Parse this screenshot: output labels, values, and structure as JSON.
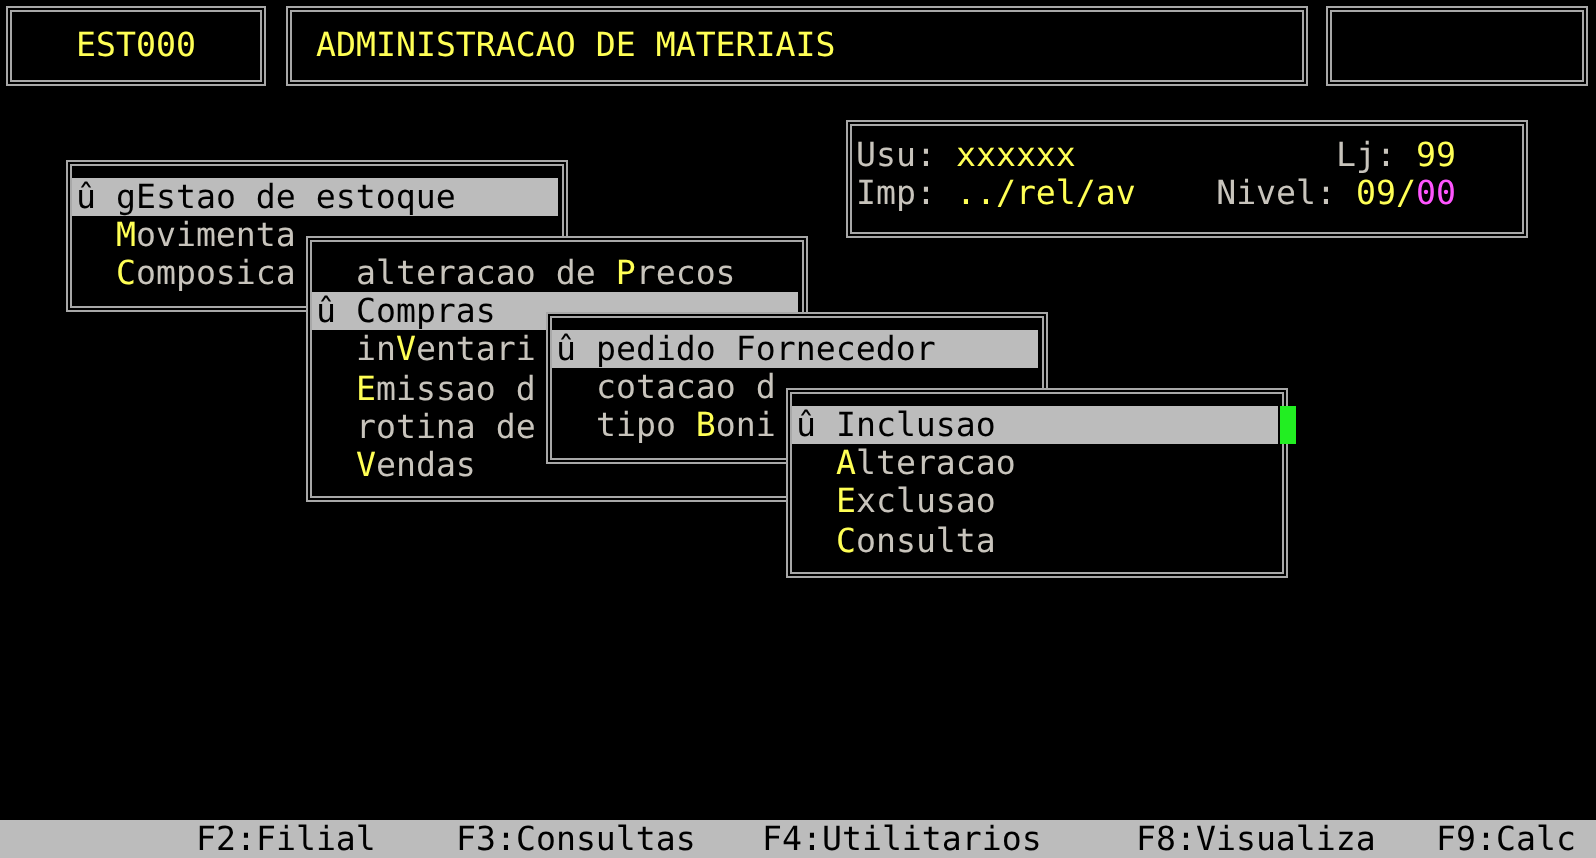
{
  "header": {
    "program_code": "EST000",
    "title": "ADMINISTRACAO DE MATERIAIS"
  },
  "session": {
    "user_label": "Usu:",
    "user": "xxxxxx",
    "store_label": "Lj:",
    "store": "99",
    "printer_label": "Imp:",
    "printer": "../rel/av",
    "level_label": "Nivel:",
    "level_main": "09/",
    "level_sub": "00"
  },
  "menus": [
    {
      "items": [
        {
          "marker": "û",
          "pre": "g",
          "key": "E",
          "post": "stao de estoque",
          "selected": true
        },
        {
          "key": "M",
          "post": "ovimenta",
          "selected": false
        },
        {
          "key": "C",
          "post": "omposica",
          "selected": false
        }
      ]
    },
    {
      "items": [
        {
          "pre": "alteracao de ",
          "key": "P",
          "post": "recos",
          "selected": false
        },
        {
          "marker": "û",
          "pre": "Compras",
          "selected": true
        },
        {
          "pre": "in",
          "key": "V",
          "post": "entari",
          "selected": false
        },
        {
          "key": "E",
          "post": "missao d",
          "selected": false
        },
        {
          "pre": "rotina de",
          "selected": false
        },
        {
          "key": "V",
          "post": "endas",
          "selected": false
        }
      ]
    },
    {
      "items": [
        {
          "marker": "û",
          "pre": "pedido Fornecedor",
          "selected": true
        },
        {
          "pre": "cotacao d",
          "selected": false
        },
        {
          "pre": "tipo ",
          "key": "B",
          "post": "oni",
          "selected": false
        }
      ]
    },
    {
      "items": [
        {
          "marker": "û",
          "pre": "Inclusao",
          "selected": true
        },
        {
          "key": "A",
          "post": "lteracao",
          "selected": false
        },
        {
          "key": "E",
          "post": "xclusao",
          "selected": false
        },
        {
          "key": "C",
          "post": "onsulta",
          "selected": false
        }
      ]
    }
  ],
  "function_keys": [
    "F2:Filial",
    "F3:Consultas",
    "F4:Utilitarios",
    "F8:Visualiza",
    "F9:Calc"
  ]
}
